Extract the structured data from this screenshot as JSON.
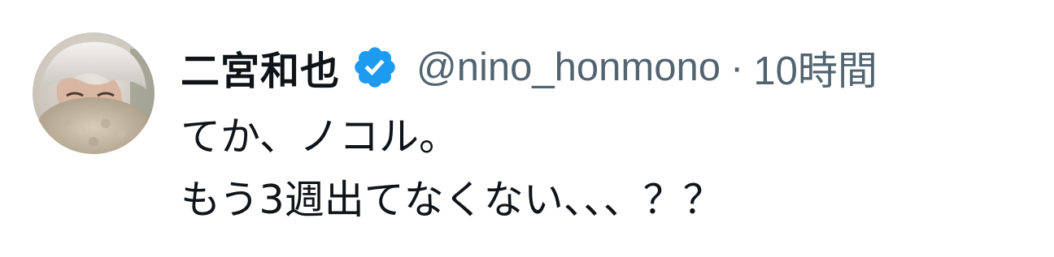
{
  "tweet": {
    "display_name": "二宮和也",
    "verified_icon": "verified-badge-icon",
    "handle": "@nino_honmono",
    "separator": "·",
    "timestamp": "10時間",
    "text_lines": [
      "てか、ノコル。",
      "もう3週出てなくない、、、？？"
    ]
  },
  "colors": {
    "text_primary": "#0f1419",
    "text_secondary": "#536471",
    "verified": "#1d9bf0",
    "background": "#ffffff"
  }
}
